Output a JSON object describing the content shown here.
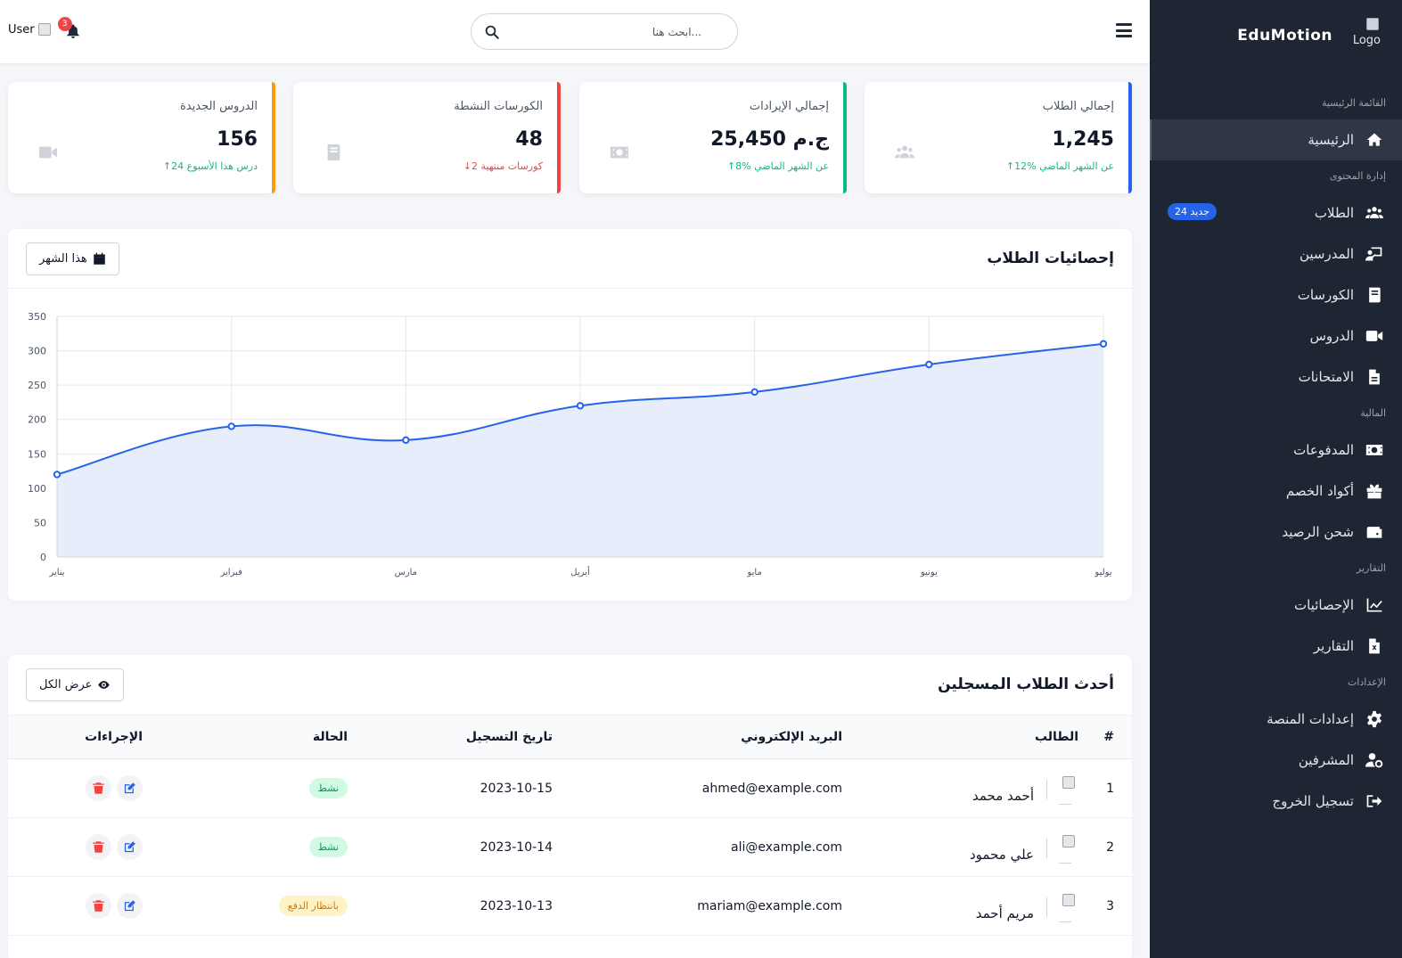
{
  "sidebar": {
    "brand": "EduMotion",
    "logo_alt": "Logo",
    "sections": {
      "main": "القائمة الرئيسية",
      "content": "إدارة المحتوى",
      "finance": "المالية",
      "reports": "التقارير",
      "settings": "الإعدادات"
    },
    "items": {
      "home": "الرئيسية",
      "students": "الطلاب",
      "students_badge": "24 جديد",
      "teachers": "المدرسين",
      "courses": "الكورسات",
      "lessons": "الدروس",
      "exams": "الامتحانات",
      "payments": "المدفوعات",
      "coupons": "أكواد الخصم",
      "topup": "شحن الرصيد",
      "stats": "الإحصائيات",
      "reports": "التقارير",
      "platform_settings": "إعدادات المنصة",
      "admins": "المشرفين",
      "logout": "تسجيل الخروج"
    }
  },
  "topbar": {
    "search_placeholder": "ابحث هنا...",
    "user_alt": "User",
    "notifications_count": "3"
  },
  "cards": [
    {
      "title": "إجمالي الطلاب",
      "value": "1,245",
      "note": "12% عن الشهر الماضي",
      "trend": "up",
      "color": "#2563eb",
      "icon": "users-icon"
    },
    {
      "title": "إجمالي الإيرادات",
      "value": "25,450 ج.م",
      "note": "8% عن الشهر الماضي",
      "trend": "up",
      "color": "#10b981",
      "icon": "money-icon"
    },
    {
      "title": "الكورسات النشطة",
      "value": "48",
      "note": "2 كورسات منتهية",
      "trend": "down",
      "color": "#ef4444",
      "icon": "book-icon"
    },
    {
      "title": "الدروس الجديدة",
      "value": "156",
      "note": "24 درس هذا الأسبوع",
      "trend": "up",
      "color": "#f59e0b",
      "icon": "video-icon"
    }
  ],
  "chart_panel": {
    "title": "إحصائيات الطلاب",
    "button": "هذا الشهر"
  },
  "chart_data": {
    "type": "area",
    "categories": [
      "يناير",
      "فبراير",
      "مارس",
      "أبريل",
      "مايو",
      "يونيو",
      "يوليو"
    ],
    "values": [
      120,
      190,
      170,
      220,
      240,
      280,
      310
    ],
    "ylim": [
      0,
      350
    ],
    "yticks": [
      0,
      50,
      100,
      150,
      200,
      250,
      300,
      350
    ],
    "line_color": "#2563eb",
    "fill_color": "#e8edfb",
    "grid": true
  },
  "table_panel": {
    "title": "أحدث الطلاب المسجلين",
    "button": "عرض الكل",
    "headers": [
      "#",
      "الطالب",
      "البريد الإلكتروني",
      "تاريخ التسجيل",
      "الحالة",
      "الإجراءات"
    ],
    "rows": [
      {
        "num": "1",
        "name": "أحمد محمد",
        "email": "ahmed@example.com",
        "date": "2023-10-15",
        "status": "نشط",
        "status_type": "active"
      },
      {
        "num": "2",
        "name": "علي محمود",
        "email": "ali@example.com",
        "date": "2023-10-14",
        "status": "نشط",
        "status_type": "active"
      },
      {
        "num": "3",
        "name": "مريم أحمد",
        "email": "mariam@example.com",
        "date": "2023-10-13",
        "status": "بانتظار الدفع",
        "status_type": "pending"
      }
    ]
  }
}
